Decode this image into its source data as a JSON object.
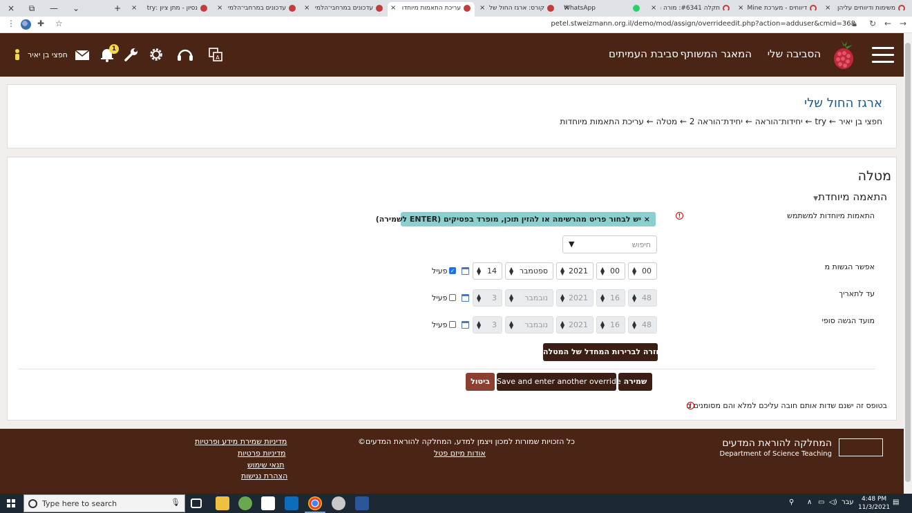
{
  "browser": {
    "tabs": [
      {
        "title": "נסיון - מתן ציון :try",
        "active": false
      },
      {
        "title": "עדכונים במרחבי־הלמי",
        "active": false
      },
      {
        "title": "עדכונים במרחבי־הלמי",
        "active": false
      },
      {
        "title": "עריכת התאמות מיוחדו",
        "active": true
      },
      {
        "title": "קורס: ארגז החול שלי",
        "active": false
      },
      {
        "title": "WhatsApp",
        "active": false
      },
      {
        "title": "תקלה #6341: מורה מו",
        "active": false
      },
      {
        "title": "דיווחים - מערכת Mine",
        "active": false
      },
      {
        "title": "משימות ודיווחים עליהן",
        "active": false
      }
    ],
    "url": "petel.stweizmann.org.il/demo/mod/assign/overrideedit.php?action=adduser&cmid=368",
    "new_tab": "+",
    "close": "×"
  },
  "header": {
    "nav": [
      "הסביבה שלי",
      "המאגר המשותף",
      "סביבת העמיתים"
    ],
    "notification_count": "1",
    "user_name": "חפצי בן יאיר"
  },
  "page": {
    "title": "ארגז החול שלי",
    "breadcrumb": "חפצי בן יאיר ← try ← יחידות־הוראה ← יחידת־הוראה 2 ← מטלה ← עריכת התאמות מיוחדות"
  },
  "form": {
    "section_title": "מטלה",
    "subsection_title": "התאמה מיוחדת",
    "user_override_label": "התאמות מיוחדות למשתמש",
    "notice": "× יש לבחור פריט מהרשימה או להזין תוכן, מופרד בפסיקים (ENTER לשמירה)",
    "search_placeholder": "חיפוש",
    "allow_from": {
      "label": "אפשר הגשות מ",
      "day": "14",
      "month": "ספטמבר",
      "year": "2021",
      "hour": "00",
      "minute": "00",
      "enable_label": "פעיל",
      "enabled": true
    },
    "due_date": {
      "label": "עד לתאריך",
      "day": "3",
      "month": "נובמבר",
      "year": "2021",
      "hour": "16",
      "minute": "48",
      "enable_label": "פעיל",
      "enabled": false
    },
    "cutoff": {
      "label": "מועד הגשה סופי",
      "day": "3",
      "month": "נובמבר",
      "year": "2021",
      "hour": "16",
      "minute": "48",
      "enable_label": "פעיל",
      "enabled": false
    },
    "revert_button": "חזרה לברירות המחדל של המטלה",
    "save_button": "שמירה",
    "save_another_button": "Save and enter another override",
    "cancel_button": "ביטול",
    "required_note": "בטופס זה ישנם שדות אותם חובה עליכם למלא והם מסומנים ב"
  },
  "footer": {
    "dept_he": "המחלקה להוראת המדעים",
    "dept_en": "Department of Science Teaching",
    "copyright": "©כל הזכויות שמורות למכון ויצמן למדע, המחלקה להוראת המדעים",
    "about": "אודות מיזם פטל",
    "links": [
      "מדיניות שמירת מידע ופרטיות",
      "מדיניות פרטיות",
      "תנאי שימוש",
      "הצהרת נגישות"
    ]
  },
  "taskbar": {
    "search_placeholder": "Type here to search",
    "time": "4:48 PM",
    "date": "11/3/2021",
    "lang": "עבר"
  },
  "colors": {
    "header_bg": "#4a2515",
    "button_dark": "#3b1f14",
    "cancel_bg": "#8b4031",
    "notice_bg": "#8bd0cf",
    "title_blue": "#1a5a8a"
  }
}
